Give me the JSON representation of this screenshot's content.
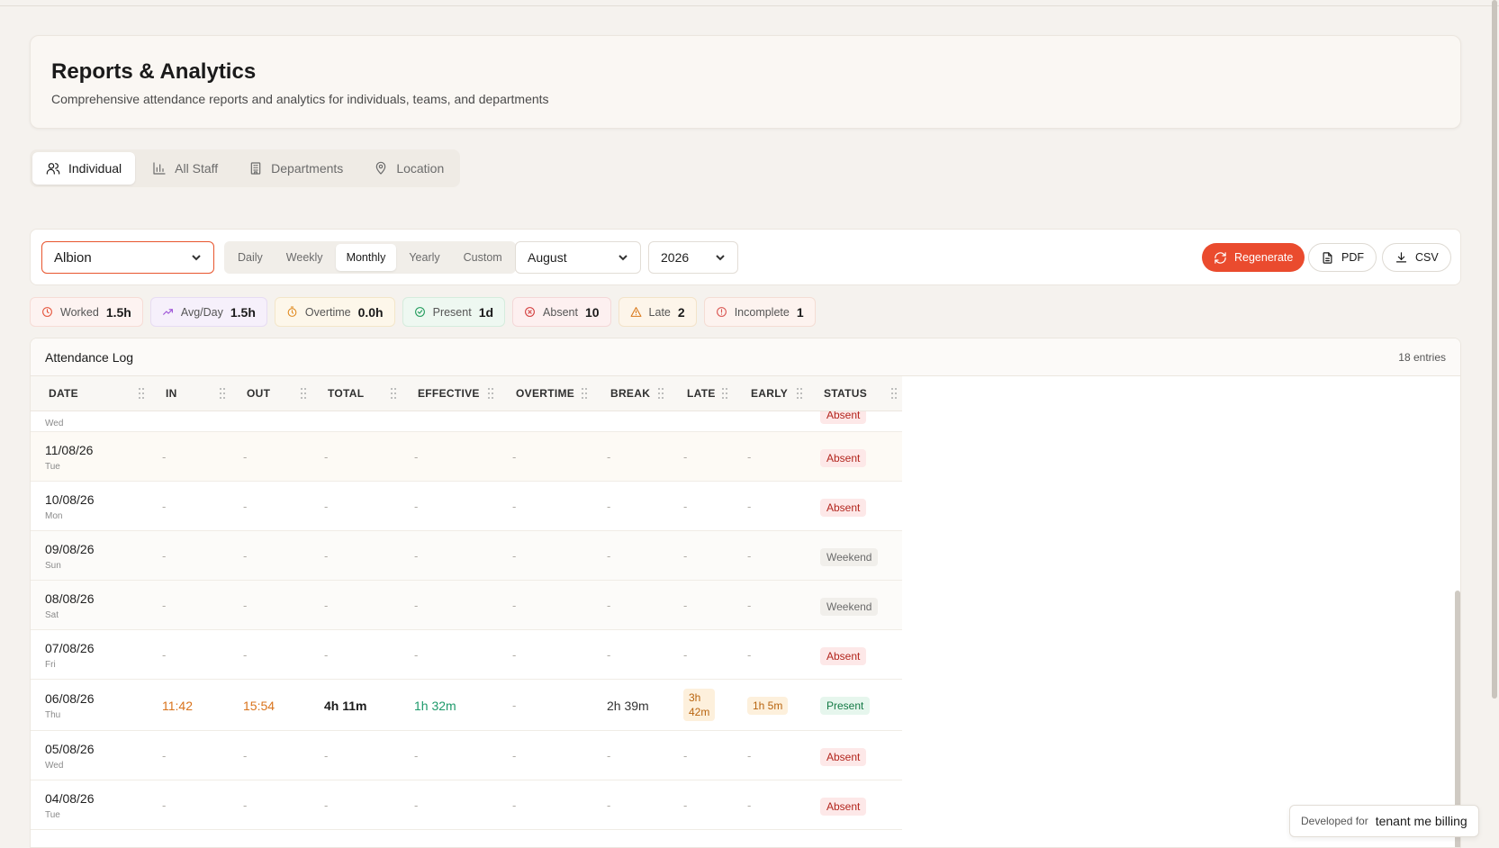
{
  "header": {
    "title": "Reports & Analytics",
    "subtitle": "Comprehensive attendance reports and analytics for individuals, teams, and departments"
  },
  "tabs": [
    {
      "label": "Individual",
      "icon": "users-icon",
      "active": true
    },
    {
      "label": "All Staff",
      "icon": "bar-chart-icon",
      "active": false
    },
    {
      "label": "Departments",
      "icon": "building-icon",
      "active": false
    },
    {
      "label": "Location",
      "icon": "map-pin-icon",
      "active": false
    }
  ],
  "filters": {
    "employee": "Albion",
    "periods": [
      "Daily",
      "Weekly",
      "Monthly",
      "Yearly",
      "Custom"
    ],
    "active_period": "Monthly",
    "month": "August",
    "year": "2026"
  },
  "actions": {
    "regenerate": "Regenerate",
    "pdf": "PDF",
    "csv": "CSV"
  },
  "stats": [
    {
      "label": "Worked",
      "value": "1.5h",
      "icon": "clock-icon",
      "color": "#e5533a"
    },
    {
      "label": "Avg/Day",
      "value": "1.5h",
      "icon": "trending-up-icon",
      "color": "#9b4fd6"
    },
    {
      "label": "Overtime",
      "value": "0.0h",
      "icon": "timer-icon",
      "color": "#e08a1e"
    },
    {
      "label": "Present",
      "value": "1d",
      "icon": "check-circle-icon",
      "color": "#1e9a5a"
    },
    {
      "label": "Absent",
      "value": "10",
      "icon": "x-circle-icon",
      "color": "#d23a3a"
    },
    {
      "label": "Late",
      "value": "2",
      "icon": "alert-triangle-icon",
      "color": "#d9791c"
    },
    {
      "label": "Incomplete",
      "value": "1",
      "icon": "alert-circle-icon",
      "color": "#d9534f"
    }
  ],
  "log": {
    "title": "Attendance Log",
    "count": "18 entries",
    "columns": [
      "DATE",
      "IN",
      "OUT",
      "TOTAL",
      "EFFECTIVE",
      "OVERTIME",
      "BREAK",
      "LATE",
      "EARLY",
      "STATUS"
    ],
    "partial_row": {
      "day": "Wed",
      "status": "Absent"
    },
    "rows": [
      {
        "date": "11/08/26",
        "day": "Tue",
        "status": "Absent",
        "dash": "-"
      },
      {
        "date": "10/08/26",
        "day": "Mon",
        "status": "Absent",
        "dash": "-"
      },
      {
        "date": "09/08/26",
        "day": "Sun",
        "status": "Weekend",
        "dash": "-"
      },
      {
        "date": "08/08/26",
        "day": "Sat",
        "status": "Weekend",
        "dash": "-"
      },
      {
        "date": "07/08/26",
        "day": "Fri",
        "status": "Absent",
        "dash": "-"
      },
      {
        "date": "06/08/26",
        "day": "Thu",
        "in": "11:42",
        "out": "15:54",
        "total": "4h 11m",
        "effective": "1h 32m",
        "overtime": "-",
        "break": "2h 39m",
        "late_line1": "3h",
        "late_line2": "42m",
        "early": "1h 5m",
        "status": "Present"
      },
      {
        "date": "05/08/26",
        "day": "Wed",
        "status": "Absent",
        "dash": "-"
      },
      {
        "date": "04/08/26",
        "day": "Tue",
        "status": "Absent",
        "dash": "-"
      }
    ]
  },
  "developer": {
    "label": "Developed for",
    "name": "tenant me billing"
  }
}
